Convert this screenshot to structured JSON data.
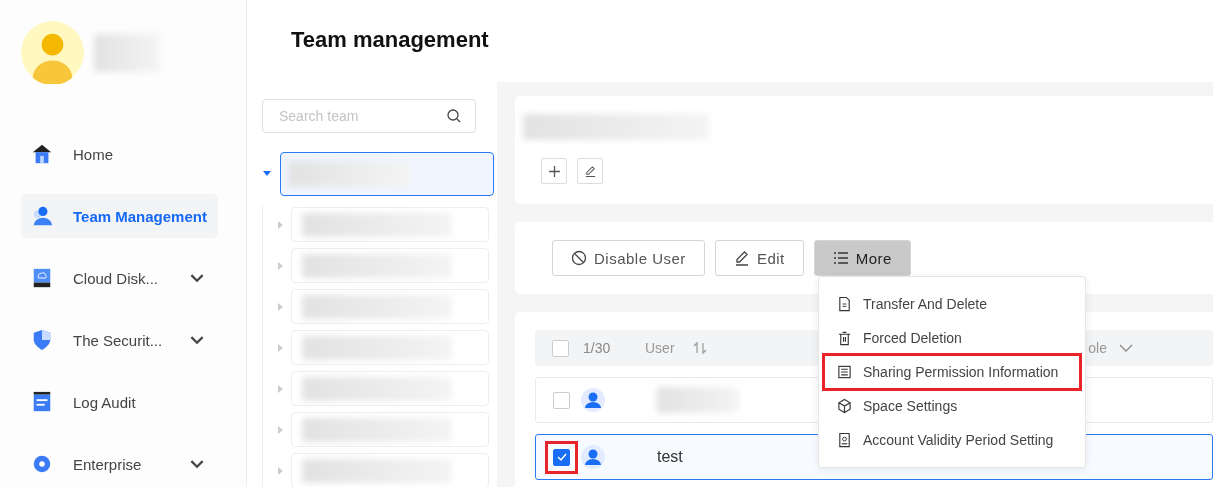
{
  "nav": [
    {
      "label": "Home",
      "selected": false,
      "has_submenu": false
    },
    {
      "label": "Team Management",
      "selected": true,
      "has_submenu": false
    },
    {
      "label": "Cloud Disk...",
      "selected": false,
      "has_submenu": true
    },
    {
      "label": "The Securit...",
      "selected": false,
      "has_submenu": true
    },
    {
      "label": "Log Audit",
      "selected": false,
      "has_submenu": false
    },
    {
      "label": "Enterprise",
      "selected": false,
      "has_submenu": true
    }
  ],
  "page_title": "Team management",
  "team_search": {
    "placeholder": "Search team"
  },
  "team_tree": {
    "selected": true,
    "expanded": true,
    "children": [
      {
        "expanded": false
      },
      {
        "expanded": false
      },
      {
        "expanded": false
      },
      {
        "expanded": false
      },
      {
        "expanded": false
      },
      {
        "expanded": false
      },
      {
        "expanded": false
      }
    ]
  },
  "actions": [
    {
      "label": "Disable User",
      "selected": false
    },
    {
      "label": "Edit",
      "selected": false
    },
    {
      "label": "More",
      "selected": true
    }
  ],
  "more_menu": [
    {
      "label": "Transfer And Delete",
      "highlighted": false
    },
    {
      "label": "Forced Deletion",
      "highlighted": false
    },
    {
      "label": "Sharing Permission Information",
      "highlighted": true
    },
    {
      "label": "Space Settings",
      "highlighted": false
    },
    {
      "label": "Account Validity Period Setting",
      "highlighted": false
    }
  ],
  "table": {
    "all_checked": false,
    "count": "1/30",
    "columns": [
      "User",
      "ole"
    ],
    "rows": [
      {
        "checked": false,
        "selected": false,
        "highlighted": false
      },
      {
        "name": "test",
        "checked": true,
        "selected": true,
        "highlighted": true
      }
    ]
  }
}
